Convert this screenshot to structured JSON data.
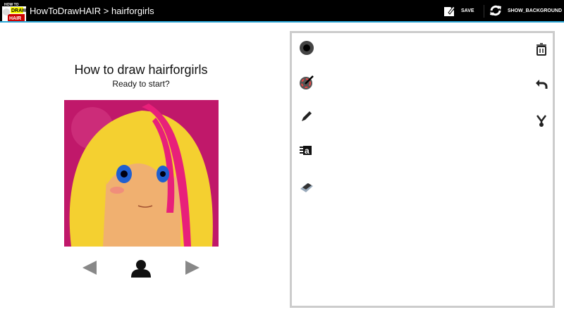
{
  "actionbar": {
    "app_name": "HowToDrawHAIR",
    "separator": ">",
    "section": "hairforgirls",
    "save_label": "SAVE",
    "show_background_label": "SHOW_BACKGROUND",
    "accent": "#2aa7d8",
    "logo_text": "HOW TO DRAW HAIR"
  },
  "main": {
    "heading": "How to draw hairforgirls",
    "subheading": "Ready to start?"
  },
  "tools": {
    "left": [
      "brush-size-icon",
      "color-picker-icon",
      "pencil-icon",
      "text-icon",
      "eraser-icon"
    ],
    "right": [
      "trash-icon",
      "undo-icon",
      "share-icon"
    ]
  }
}
